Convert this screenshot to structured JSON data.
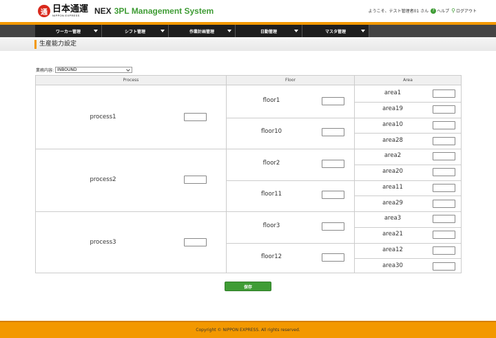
{
  "header": {
    "logo_jp": "日本通運",
    "logo_en": "NIPPON EXPRESS",
    "logo_seal": "通",
    "app_brand": "NEX",
    "app_title": "3PL Management System",
    "welcome": "ようこそ、テスト管理者01 さん",
    "help_label": "ヘルプ",
    "logout_label": "ログアウト"
  },
  "nav": {
    "items": [
      {
        "label": "ワーカー管理"
      },
      {
        "label": "シフト管理"
      },
      {
        "label": "作業計画管理"
      },
      {
        "label": "日勤管理"
      },
      {
        "label": "マスタ管理"
      }
    ]
  },
  "page": {
    "title": "生産能力設定",
    "filter_label": "業務内容:",
    "filter_value": "INBOUND"
  },
  "table": {
    "headers": {
      "process": "Process",
      "floor": "Floor",
      "area": "Area"
    },
    "processes": [
      {
        "name": "process1",
        "value": "",
        "floors": [
          {
            "name": "floor1",
            "value": "",
            "areas": [
              {
                "name": "area1",
                "value": ""
              },
              {
                "name": "area19",
                "value": ""
              }
            ]
          },
          {
            "name": "floor10",
            "value": "",
            "areas": [
              {
                "name": "area10",
                "value": ""
              },
              {
                "name": "area28",
                "value": ""
              }
            ]
          }
        ]
      },
      {
        "name": "process2",
        "value": "",
        "floors": [
          {
            "name": "floor2",
            "value": "",
            "areas": [
              {
                "name": "area2",
                "value": ""
              },
              {
                "name": "area20",
                "value": ""
              }
            ]
          },
          {
            "name": "floor11",
            "value": "",
            "areas": [
              {
                "name": "area11",
                "value": ""
              },
              {
                "name": "area29",
                "value": ""
              }
            ]
          }
        ]
      },
      {
        "name": "process3",
        "value": "",
        "floors": [
          {
            "name": "floor3",
            "value": "",
            "areas": [
              {
                "name": "area3",
                "value": ""
              },
              {
                "name": "area21",
                "value": ""
              }
            ]
          },
          {
            "name": "floor12",
            "value": "",
            "areas": [
              {
                "name": "area12",
                "value": ""
              },
              {
                "name": "area30",
                "value": ""
              }
            ]
          }
        ]
      }
    ]
  },
  "actions": {
    "save_label": "保存"
  },
  "footer": {
    "copyright": "Copyright © NIPPON EXPRESS. All rights reserved."
  },
  "colors": {
    "accent": "#f39800",
    "brand_green": "#3f9c35",
    "nav_bg": "#1e1e1e",
    "logo_red": "#d9291c"
  }
}
